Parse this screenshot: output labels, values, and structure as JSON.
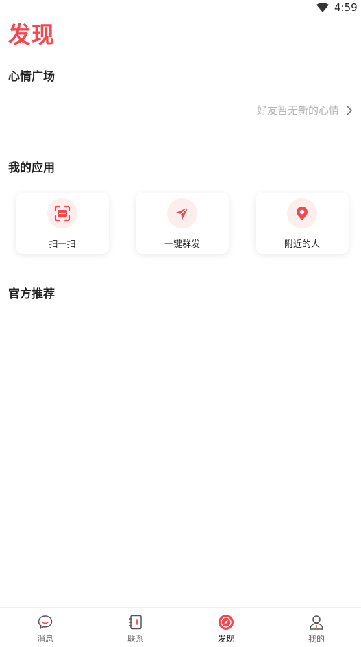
{
  "status": {
    "time": "4:59",
    "wifi_icon": "wifi-icon"
  },
  "header": {
    "title": "发现"
  },
  "sections": {
    "mood": {
      "title": "心情广场",
      "empty_text": "好友暂无新的心情"
    },
    "apps": {
      "title": "我的应用",
      "items": [
        {
          "label": "扫一扫",
          "icon": "scan-icon"
        },
        {
          "label": "一键群发",
          "icon": "paper-plane-icon"
        },
        {
          "label": "附近的人",
          "icon": "location-pin-icon"
        }
      ]
    },
    "official": {
      "title": "官方推荐"
    }
  },
  "tabbar": {
    "active": 2,
    "items": [
      {
        "label": "消息",
        "icon": "chat-bubble-icon"
      },
      {
        "label": "联系",
        "icon": "contact-book-icon"
      },
      {
        "label": "发现",
        "icon": "compass-icon"
      },
      {
        "label": "我的",
        "icon": "profile-icon"
      }
    ]
  },
  "colors": {
    "accent": "#f2484d",
    "muted": "#b4b4b4",
    "icon_bg": "#fdeeee"
  }
}
